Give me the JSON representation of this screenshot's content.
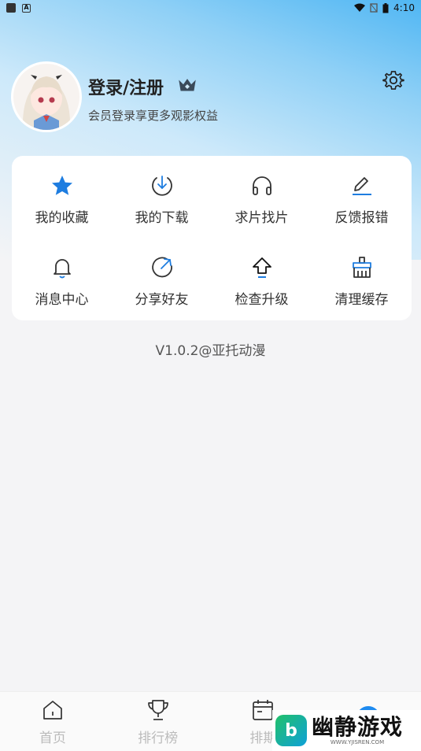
{
  "status_bar": {
    "time": "4:10"
  },
  "profile": {
    "title": "登录/注册",
    "subtitle": "会员登录享更多观影权益"
  },
  "menu": [
    {
      "label": "我的收藏",
      "icon": "star-icon"
    },
    {
      "label": "我的下载",
      "icon": "download-icon"
    },
    {
      "label": "求片找片",
      "icon": "headphones-icon"
    },
    {
      "label": "反馈报错",
      "icon": "edit-icon"
    },
    {
      "label": "消息中心",
      "icon": "bell-icon"
    },
    {
      "label": "分享好友",
      "icon": "share-icon"
    },
    {
      "label": "检查升级",
      "icon": "upgrade-icon"
    },
    {
      "label": "清理缓存",
      "icon": "clean-icon"
    }
  ],
  "version": "V1.0.2@亚托动漫",
  "tabs": [
    {
      "label": "首页",
      "icon": "home-icon"
    },
    {
      "label": "排行榜",
      "icon": "trophy-icon"
    },
    {
      "label": "排期",
      "icon": "calendar-icon"
    },
    {
      "label": "",
      "icon": "profile-dot-icon"
    }
  ],
  "watermark": {
    "title": "幽静游戏",
    "url": "WWW.YJISREN.COM",
    "logo_letter": "b"
  },
  "colors": {
    "accent": "#1e8bf0",
    "gradient_top": "#4fb6f3"
  }
}
